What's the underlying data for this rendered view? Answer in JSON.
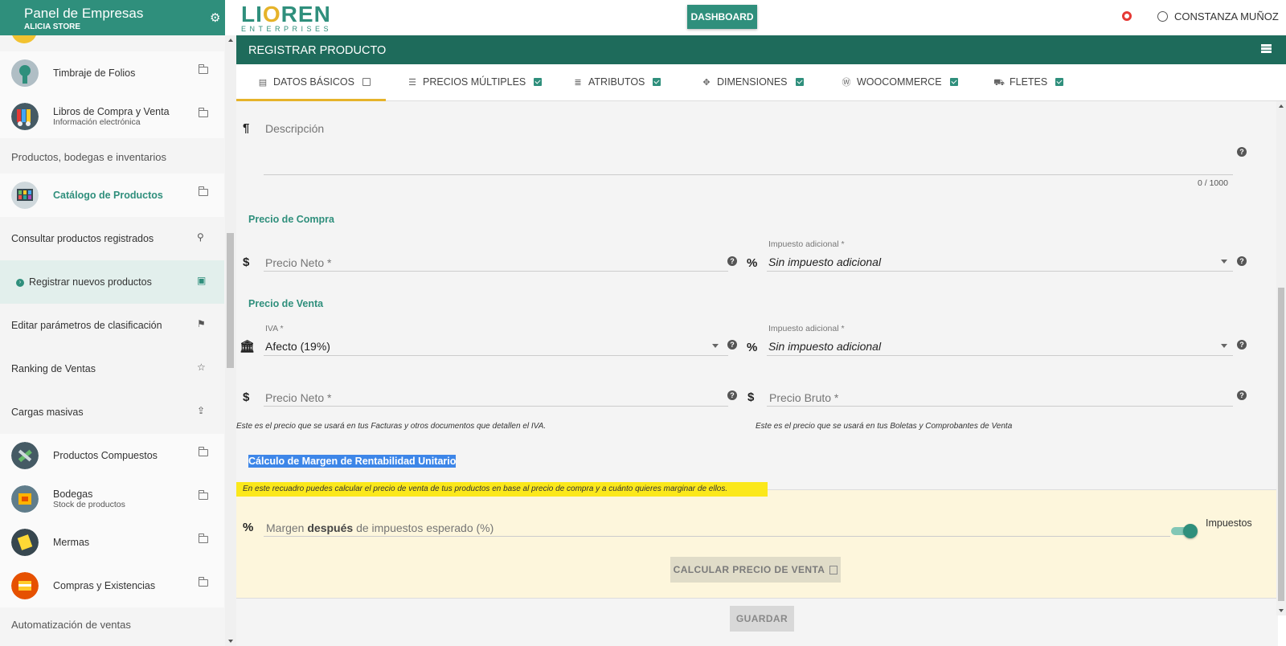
{
  "sidebar": {
    "panel_title": "Panel de Empresas",
    "store_name": "ALICIA STORE",
    "items": [
      {
        "label": "Timbraje de Folios",
        "sub": ""
      },
      {
        "label": "Libros de Compra y Venta",
        "sub": "Información electrónica"
      },
      {
        "label": "Catálogo de Productos",
        "sub": ""
      },
      {
        "label": "Consultar productos registrados",
        "sub": ""
      },
      {
        "label": "Registrar nuevos productos",
        "sub": ""
      },
      {
        "label": "Editar parámetros de clasificación",
        "sub": ""
      },
      {
        "label": "Ranking de Ventas",
        "sub": ""
      },
      {
        "label": "Cargas masivas",
        "sub": ""
      },
      {
        "label": "Productos Compuestos",
        "sub": ""
      },
      {
        "label": "Bodegas",
        "sub": "Stock de productos"
      },
      {
        "label": "Mermas",
        "sub": ""
      },
      {
        "label": "Compras y Existencias",
        "sub": ""
      }
    ],
    "sections": [
      "Productos, bodegas e inventarios",
      "Automatización de ventas"
    ]
  },
  "topbar": {
    "logo_main": "LIOREN",
    "logo_sub": "ENTERPRISES",
    "dashboard_label": "DASHBOARD",
    "user_name": "CONSTANZA MUÑOZ"
  },
  "page": {
    "title": "REGISTRAR PRODUCTO",
    "tabs": [
      {
        "label": "DATOS BÁSICOS",
        "checked": false
      },
      {
        "label": "PRECIOS MÚLTIPLES",
        "checked": true
      },
      {
        "label": "ATRIBUTOS",
        "checked": true
      },
      {
        "label": "DIMENSIONES",
        "checked": true
      },
      {
        "label": "WOOCOMMERCE",
        "checked": true
      },
      {
        "label": "FLETES",
        "checked": true
      }
    ]
  },
  "form": {
    "description": {
      "placeholder": "Descripción",
      "counter": "0 / 1000"
    },
    "compra": {
      "section": "Precio de Compra",
      "neto_placeholder": "Precio Neto *",
      "impuesto_label": "Impuesto adicional *",
      "impuesto_value": "Sin impuesto adicional"
    },
    "venta": {
      "section": "Precio de Venta",
      "iva_label": "IVA *",
      "iva_value": "Afecto (19%)",
      "impuesto_label": "Impuesto adicional *",
      "impuesto_value": "Sin impuesto adicional",
      "neto_placeholder": "Precio Neto *",
      "bruto_placeholder": "Precio Bruto *",
      "neto_note": "Este es el precio que se usará en tus Facturas y otros documentos que detallen el IVA.",
      "bruto_note": "Este es el precio que se usará en tus Boletas y Comprobantes de Venta"
    },
    "margen": {
      "title": "Cálculo de Margen de Rentabilidad Unitario",
      "note": "En este recuadro puedes calcular el precio de venta de tus productos en base al precio de compra y a cuánto quieres marginar de ellos.",
      "placeholder_pre": "Margen",
      "placeholder_bold": "después",
      "placeholder_post": "de impuestos esperado (%)",
      "toggle_label": "Impuestos",
      "toggle_on": true,
      "calc_button": "CALCULAR PRECIO DE VENTA"
    },
    "save_button": "GUARDAR"
  },
  "colors": {
    "brand": "#2f8f7c",
    "title_bar": "#1e6b5b",
    "accent": "#e6b32a",
    "highlight": "#fbe81b"
  }
}
